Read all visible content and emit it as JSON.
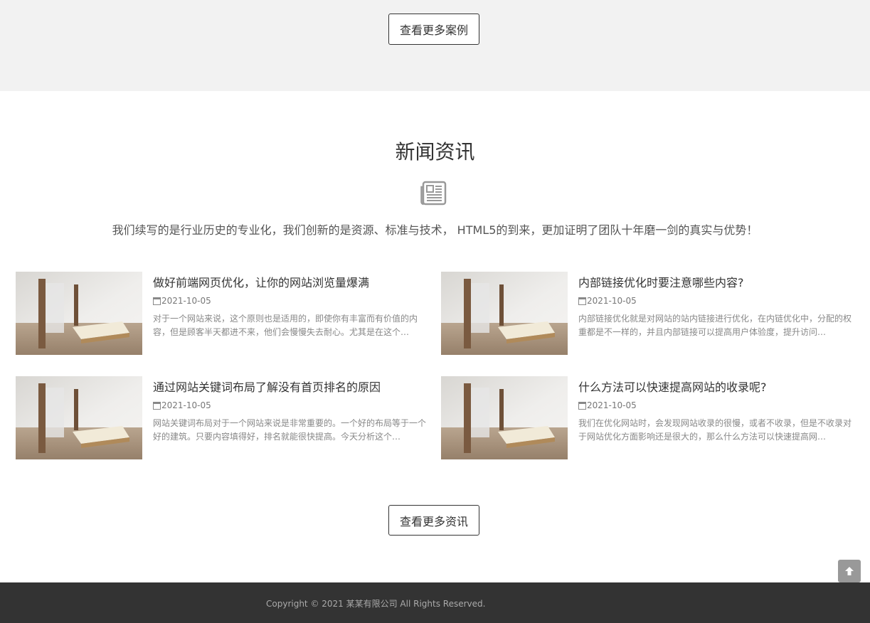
{
  "cases": {
    "more_label": "查看更多案例"
  },
  "news": {
    "title": "新闻资讯",
    "subtitle": "我们续写的是行业历史的专业化，我们创新的是资源、标准与技术， HTML5的到来，更加证明了团队十年磨一剑的真实与优势！",
    "icon": "newspaper-icon",
    "items": [
      {
        "title": "做好前端网页优化，让你的网站浏览量爆满",
        "date": "2021-10-05",
        "desc": "对于一个网站来说，这个原则也是适用的，即使你有丰富而有价值的内容，但是顾客半天都进不来，他们会慢慢失去耐心。尤其是在这个…"
      },
      {
        "title": "内部链接优化时要注意哪些内容?",
        "date": "2021-10-05",
        "desc": "内部链接优化就是对网站的站内链接进行优化，在内链优化中，分配的权重都是不一样的，并且内部链接可以提高用户体验度，提升访问…"
      },
      {
        "title": "通过网站关键词布局了解没有首页排名的原因",
        "date": "2021-10-05",
        "desc": "网站关键词布局对于一个网站来说是非常重要的。一个好的布局等于一个好的建筑。只要内容填得好，排名就能很快提高。今天分析这个…"
      },
      {
        "title": "什么方法可以快速提高网站的收录呢?",
        "date": "2021-10-05",
        "desc": "我们在优化网站时，会发现网站收录的很慢，或者不收录，但是不收录对于网站优化方面影响还是很大的，那么什么方法可以快速提高网…"
      }
    ],
    "more_label": "查看更多资讯"
  },
  "scroll_top_icon": "arrow-up-icon",
  "footer": {
    "copyright": "Copyright © 2021 某某有限公司 All Rights Reserved."
  }
}
